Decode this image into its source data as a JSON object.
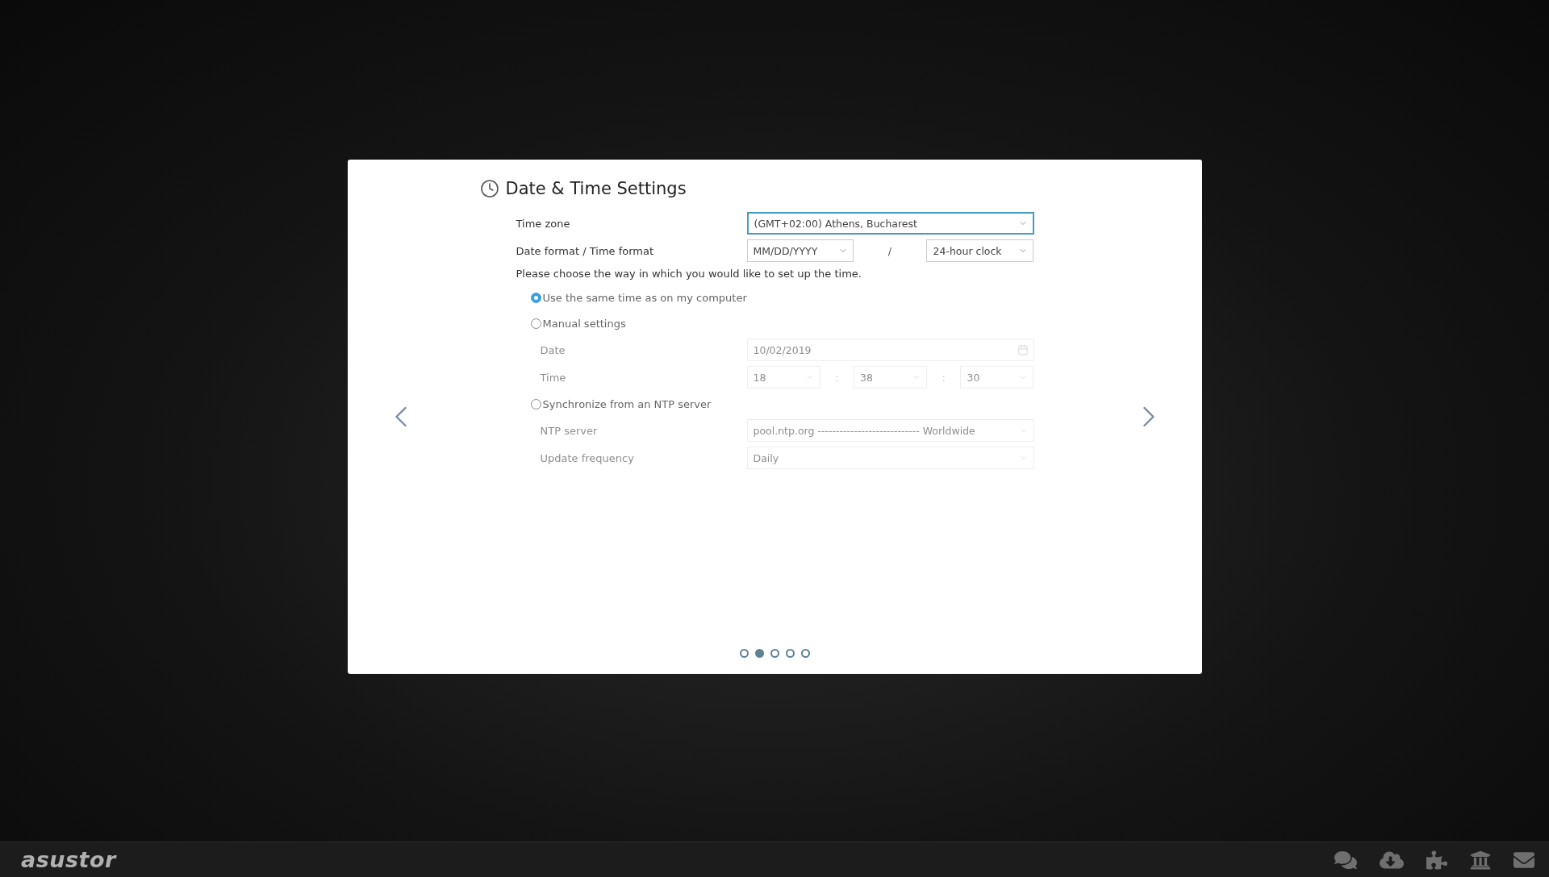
{
  "dialog": {
    "title": "Date & Time Settings",
    "time_zone": {
      "label": "Time zone",
      "value": "(GMT+02:00) Athens, Bucharest",
      "focused": true
    },
    "format": {
      "label": "Date format / Time format",
      "date_format": "MM/DD/YYYY",
      "separator": "/",
      "time_format": "24-hour clock"
    },
    "instruction": "Please choose the way in which you would like to set up the time.",
    "options": [
      {
        "label": "Use the same time as on my computer",
        "selected": true
      },
      {
        "label": "Manual settings",
        "selected": false,
        "fields": [
          {
            "kind": "date",
            "label": "Date",
            "value": "10/02/2019",
            "disabled": true
          },
          {
            "kind": "time",
            "label": "Time",
            "parts": [
              "18",
              "38",
              "30"
            ],
            "separator": ":",
            "disabled": true
          }
        ]
      },
      {
        "label": "Synchronize from an NTP server",
        "selected": false,
        "fields": [
          {
            "kind": "select",
            "label": "NTP server",
            "value": "pool.ntp.org ---------------------------- Worldwide",
            "disabled": true
          },
          {
            "kind": "select",
            "label": "Update frequency",
            "value": "Daily",
            "disabled": true
          }
        ]
      }
    ],
    "pages": [
      {
        "selected": false
      },
      {
        "selected": true
      },
      {
        "selected": false
      },
      {
        "selected": false
      },
      {
        "selected": false
      }
    ]
  },
  "taskbar": {
    "logo": "asustor"
  }
}
